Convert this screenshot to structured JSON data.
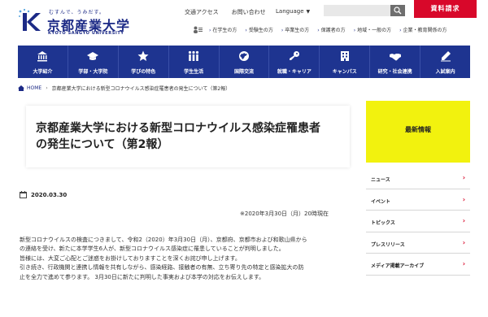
{
  "header": {
    "logo": {
      "tagline": "むすんで、うみだす。",
      "name": "京都産業大学",
      "english": "KYOTO SANGYO UNIVERSITY"
    },
    "top_links": [
      "交通アクセス",
      "お問い合わせ"
    ],
    "language_label": "Language",
    "search_placeholder": "",
    "request_button": "資料請求",
    "audience_links": [
      "在学生の方",
      "受験生の方",
      "卒業生の方",
      "保護者の方",
      "地域・一般の方",
      "企業・教育関係の方"
    ]
  },
  "nav": {
    "items": [
      {
        "label": "大学紹介",
        "icon": "university-icon"
      },
      {
        "label": "学部・大学院",
        "icon": "graduation-cap-icon"
      },
      {
        "label": "学びの特色",
        "icon": "star-icon"
      },
      {
        "label": "学生生活",
        "icon": "students-icon"
      },
      {
        "label": "国際交流",
        "icon": "globe-icon"
      },
      {
        "label": "就職・キャリア",
        "icon": "key-icon"
      },
      {
        "label": "キャンパス",
        "icon": "building-icon"
      },
      {
        "label": "研究・社会連携",
        "icon": "handshake-icon"
      },
      {
        "label": "入試案内",
        "icon": "pencil-icon"
      }
    ]
  },
  "breadcrumb": {
    "home": "HOME",
    "current": "京都産業大学における新型コロナウイルス感染症罹患者の発生について（第2報）"
  },
  "article": {
    "title": "京都産業大学における新型コロナウイルス感染症罹患者の発生について（第2報）",
    "date": "2020.03.30",
    "as_of": "※2020年3月30日（月）20時現在",
    "paragraphs": [
      "新型コロナウイルスの検査につきまして、令和2（2020）年3月30日（月）、京都府、京都市および和歌山県から",
      "の連絡を受け、新たに本学学生6人が、新型コロナウイルス感染症に罹患していることが判明しました。",
      "皆様には、大変ご心配とご迷惑をお掛けしておりますことを深くお詫び申し上げます。",
      "引き続き、行政機関と連携し情報を共有しながら、感染経路、接触者の有無、立ち寄り先の特定と感染拡大の防",
      "止を全力で進めて参ります。 3月30日に新たに判明した事実および本学の対応をお伝えします。"
    ]
  },
  "sidebar": {
    "heading": "最新情報",
    "items": [
      "ニュース",
      "イベント",
      "トピックス",
      "プレスリリース",
      "メディア掲載アーカイブ"
    ]
  },
  "colors": {
    "brand_navy": "#1e3490",
    "request_red": "#d8082a",
    "news_yellow": "#f2f20e"
  }
}
